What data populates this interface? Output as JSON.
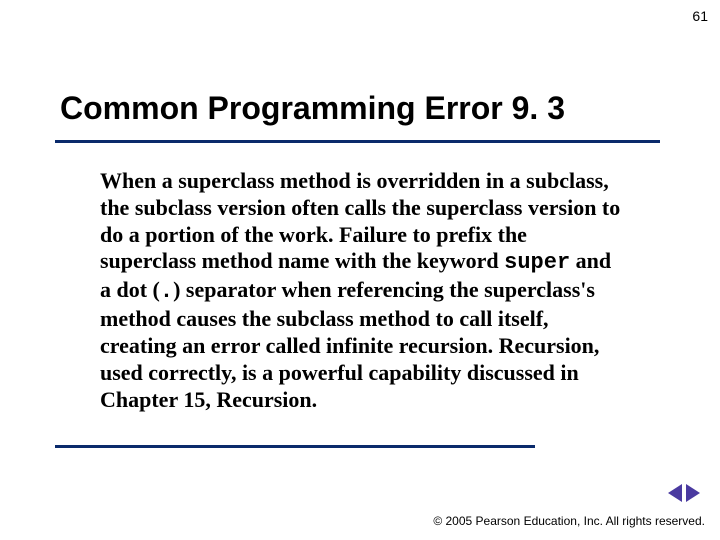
{
  "page_number": "61",
  "title": "Common Programming Error 9. 3",
  "body": {
    "part1": "When a superclass method is overridden in a subclass, the subclass version often calls the superclass version to do a portion of the work. Failure to prefix the superclass method name with the keyword ",
    "kw_super": "super",
    "part2": " and a dot (",
    "kw_dot": ".",
    "part3": ") separator when referencing the superclass's method causes the subclass method to call itself, creating an error called infinite recursion. Recursion, used correctly, is a powerful capability discussed in Chapter 15, Recursion."
  },
  "copyright_symbol": "©",
  "footer": " 2005 Pearson Education, Inc.  All rights reserved."
}
